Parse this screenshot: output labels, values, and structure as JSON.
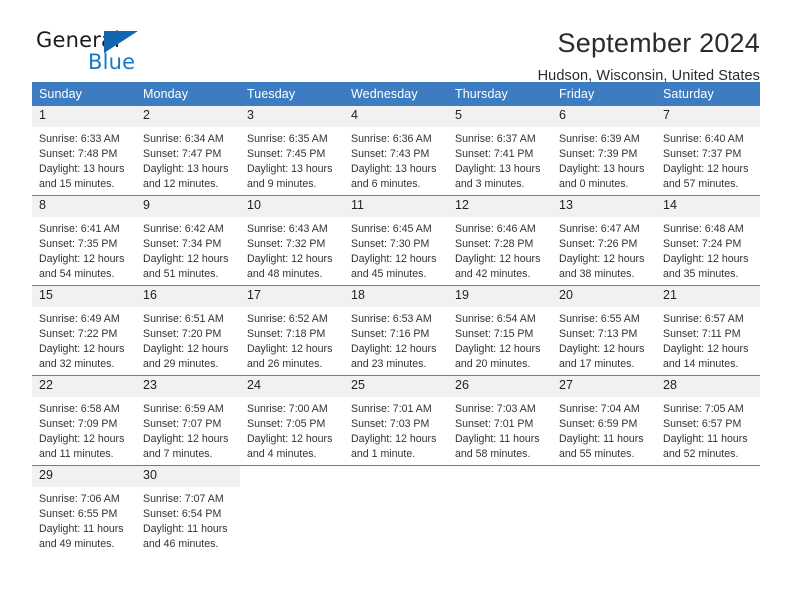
{
  "brand": {
    "name_part1": "General",
    "name_part2": "Blue",
    "logo_icon": "triangle-flag-icon",
    "accent_color": "#1878c8",
    "triangle_color": "#1266b0"
  },
  "header": {
    "month_title": "September 2024",
    "location": "Hudson, Wisconsin, United States",
    "header_bg_color": "#3d7cc0",
    "daynum_bg_color": "#f1f1f1"
  },
  "weekday_headers": [
    "Sunday",
    "Monday",
    "Tuesday",
    "Wednesday",
    "Thursday",
    "Friday",
    "Saturday"
  ],
  "weeks": [
    [
      {
        "day": "1",
        "sunrise": "Sunrise: 6:33 AM",
        "sunset": "Sunset: 7:48 PM",
        "daylight_line1": "Daylight: 13 hours",
        "daylight_line2": "and 15 minutes."
      },
      {
        "day": "2",
        "sunrise": "Sunrise: 6:34 AM",
        "sunset": "Sunset: 7:47 PM",
        "daylight_line1": "Daylight: 13 hours",
        "daylight_line2": "and 12 minutes."
      },
      {
        "day": "3",
        "sunrise": "Sunrise: 6:35 AM",
        "sunset": "Sunset: 7:45 PM",
        "daylight_line1": "Daylight: 13 hours",
        "daylight_line2": "and 9 minutes."
      },
      {
        "day": "4",
        "sunrise": "Sunrise: 6:36 AM",
        "sunset": "Sunset: 7:43 PM",
        "daylight_line1": "Daylight: 13 hours",
        "daylight_line2": "and 6 minutes."
      },
      {
        "day": "5",
        "sunrise": "Sunrise: 6:37 AM",
        "sunset": "Sunset: 7:41 PM",
        "daylight_line1": "Daylight: 13 hours",
        "daylight_line2": "and 3 minutes."
      },
      {
        "day": "6",
        "sunrise": "Sunrise: 6:39 AM",
        "sunset": "Sunset: 7:39 PM",
        "daylight_line1": "Daylight: 13 hours",
        "daylight_line2": "and 0 minutes."
      },
      {
        "day": "7",
        "sunrise": "Sunrise: 6:40 AM",
        "sunset": "Sunset: 7:37 PM",
        "daylight_line1": "Daylight: 12 hours",
        "daylight_line2": "and 57 minutes."
      }
    ],
    [
      {
        "day": "8",
        "sunrise": "Sunrise: 6:41 AM",
        "sunset": "Sunset: 7:35 PM",
        "daylight_line1": "Daylight: 12 hours",
        "daylight_line2": "and 54 minutes."
      },
      {
        "day": "9",
        "sunrise": "Sunrise: 6:42 AM",
        "sunset": "Sunset: 7:34 PM",
        "daylight_line1": "Daylight: 12 hours",
        "daylight_line2": "and 51 minutes."
      },
      {
        "day": "10",
        "sunrise": "Sunrise: 6:43 AM",
        "sunset": "Sunset: 7:32 PM",
        "daylight_line1": "Daylight: 12 hours",
        "daylight_line2": "and 48 minutes."
      },
      {
        "day": "11",
        "sunrise": "Sunrise: 6:45 AM",
        "sunset": "Sunset: 7:30 PM",
        "daylight_line1": "Daylight: 12 hours",
        "daylight_line2": "and 45 minutes."
      },
      {
        "day": "12",
        "sunrise": "Sunrise: 6:46 AM",
        "sunset": "Sunset: 7:28 PM",
        "daylight_line1": "Daylight: 12 hours",
        "daylight_line2": "and 42 minutes."
      },
      {
        "day": "13",
        "sunrise": "Sunrise: 6:47 AM",
        "sunset": "Sunset: 7:26 PM",
        "daylight_line1": "Daylight: 12 hours",
        "daylight_line2": "and 38 minutes."
      },
      {
        "day": "14",
        "sunrise": "Sunrise: 6:48 AM",
        "sunset": "Sunset: 7:24 PM",
        "daylight_line1": "Daylight: 12 hours",
        "daylight_line2": "and 35 minutes."
      }
    ],
    [
      {
        "day": "15",
        "sunrise": "Sunrise: 6:49 AM",
        "sunset": "Sunset: 7:22 PM",
        "daylight_line1": "Daylight: 12 hours",
        "daylight_line2": "and 32 minutes."
      },
      {
        "day": "16",
        "sunrise": "Sunrise: 6:51 AM",
        "sunset": "Sunset: 7:20 PM",
        "daylight_line1": "Daylight: 12 hours",
        "daylight_line2": "and 29 minutes."
      },
      {
        "day": "17",
        "sunrise": "Sunrise: 6:52 AM",
        "sunset": "Sunset: 7:18 PM",
        "daylight_line1": "Daylight: 12 hours",
        "daylight_line2": "and 26 minutes."
      },
      {
        "day": "18",
        "sunrise": "Sunrise: 6:53 AM",
        "sunset": "Sunset: 7:16 PM",
        "daylight_line1": "Daylight: 12 hours",
        "daylight_line2": "and 23 minutes."
      },
      {
        "day": "19",
        "sunrise": "Sunrise: 6:54 AM",
        "sunset": "Sunset: 7:15 PM",
        "daylight_line1": "Daylight: 12 hours",
        "daylight_line2": "and 20 minutes."
      },
      {
        "day": "20",
        "sunrise": "Sunrise: 6:55 AM",
        "sunset": "Sunset: 7:13 PM",
        "daylight_line1": "Daylight: 12 hours",
        "daylight_line2": "and 17 minutes."
      },
      {
        "day": "21",
        "sunrise": "Sunrise: 6:57 AM",
        "sunset": "Sunset: 7:11 PM",
        "daylight_line1": "Daylight: 12 hours",
        "daylight_line2": "and 14 minutes."
      }
    ],
    [
      {
        "day": "22",
        "sunrise": "Sunrise: 6:58 AM",
        "sunset": "Sunset: 7:09 PM",
        "daylight_line1": "Daylight: 12 hours",
        "daylight_line2": "and 11 minutes."
      },
      {
        "day": "23",
        "sunrise": "Sunrise: 6:59 AM",
        "sunset": "Sunset: 7:07 PM",
        "daylight_line1": "Daylight: 12 hours",
        "daylight_line2": "and 7 minutes."
      },
      {
        "day": "24",
        "sunrise": "Sunrise: 7:00 AM",
        "sunset": "Sunset: 7:05 PM",
        "daylight_line1": "Daylight: 12 hours",
        "daylight_line2": "and 4 minutes."
      },
      {
        "day": "25",
        "sunrise": "Sunrise: 7:01 AM",
        "sunset": "Sunset: 7:03 PM",
        "daylight_line1": "Daylight: 12 hours",
        "daylight_line2": "and 1 minute."
      },
      {
        "day": "26",
        "sunrise": "Sunrise: 7:03 AM",
        "sunset": "Sunset: 7:01 PM",
        "daylight_line1": "Daylight: 11 hours",
        "daylight_line2": "and 58 minutes."
      },
      {
        "day": "27",
        "sunrise": "Sunrise: 7:04 AM",
        "sunset": "Sunset: 6:59 PM",
        "daylight_line1": "Daylight: 11 hours",
        "daylight_line2": "and 55 minutes."
      },
      {
        "day": "28",
        "sunrise": "Sunrise: 7:05 AM",
        "sunset": "Sunset: 6:57 PM",
        "daylight_line1": "Daylight: 11 hours",
        "daylight_line2": "and 52 minutes."
      }
    ],
    [
      {
        "day": "29",
        "sunrise": "Sunrise: 7:06 AM",
        "sunset": "Sunset: 6:55 PM",
        "daylight_line1": "Daylight: 11 hours",
        "daylight_line2": "and 49 minutes."
      },
      {
        "day": "30",
        "sunrise": "Sunrise: 7:07 AM",
        "sunset": "Sunset: 6:54 PM",
        "daylight_line1": "Daylight: 11 hours",
        "daylight_line2": "and 46 minutes."
      },
      {
        "day": "",
        "sunrise": "",
        "sunset": "",
        "daylight_line1": "",
        "daylight_line2": ""
      },
      {
        "day": "",
        "sunrise": "",
        "sunset": "",
        "daylight_line1": "",
        "daylight_line2": ""
      },
      {
        "day": "",
        "sunrise": "",
        "sunset": "",
        "daylight_line1": "",
        "daylight_line2": ""
      },
      {
        "day": "",
        "sunrise": "",
        "sunset": "",
        "daylight_line1": "",
        "daylight_line2": ""
      },
      {
        "day": "",
        "sunrise": "",
        "sunset": "",
        "daylight_line1": "",
        "daylight_line2": ""
      }
    ]
  ]
}
